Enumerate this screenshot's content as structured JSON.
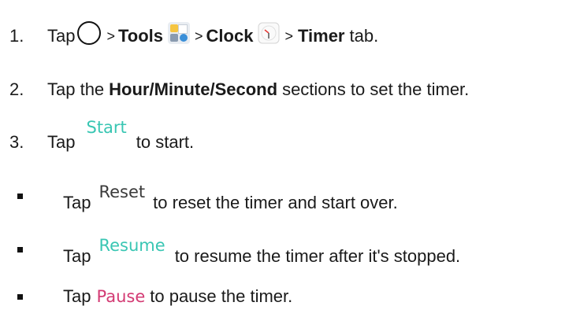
{
  "steps": [
    {
      "number": "1.",
      "tap": "Tap",
      "sep1": ">",
      "tools": "Tools",
      "sep2": ">",
      "clock": "Clock",
      "sep3": ">",
      "timer": "Timer",
      "tail": "tab."
    },
    {
      "number": "2.",
      "pre": "Tap the",
      "bold": "Hour/Minute/Second",
      "post": "sections to set the timer."
    },
    {
      "number": "3.",
      "tap": "Tap",
      "button": "Start",
      "post": "to start."
    }
  ],
  "bullets": [
    {
      "tap": "Tap",
      "button": "Reset",
      "post": "to reset the timer and start over."
    },
    {
      "tap": "Tap",
      "button": "Resume",
      "post": "to resume the timer after it's stopped."
    },
    {
      "tap": "Tap",
      "button": "Pause",
      "post": "to pause the timer."
    }
  ],
  "icons": {
    "home": "home-icon",
    "tools": "tools-folder-icon",
    "clock": "clock-app-icon"
  },
  "colors": {
    "start": "#39c6b3",
    "reset": "#3a3a3a",
    "resume": "#39c6b3",
    "pause": "#d33a73"
  }
}
